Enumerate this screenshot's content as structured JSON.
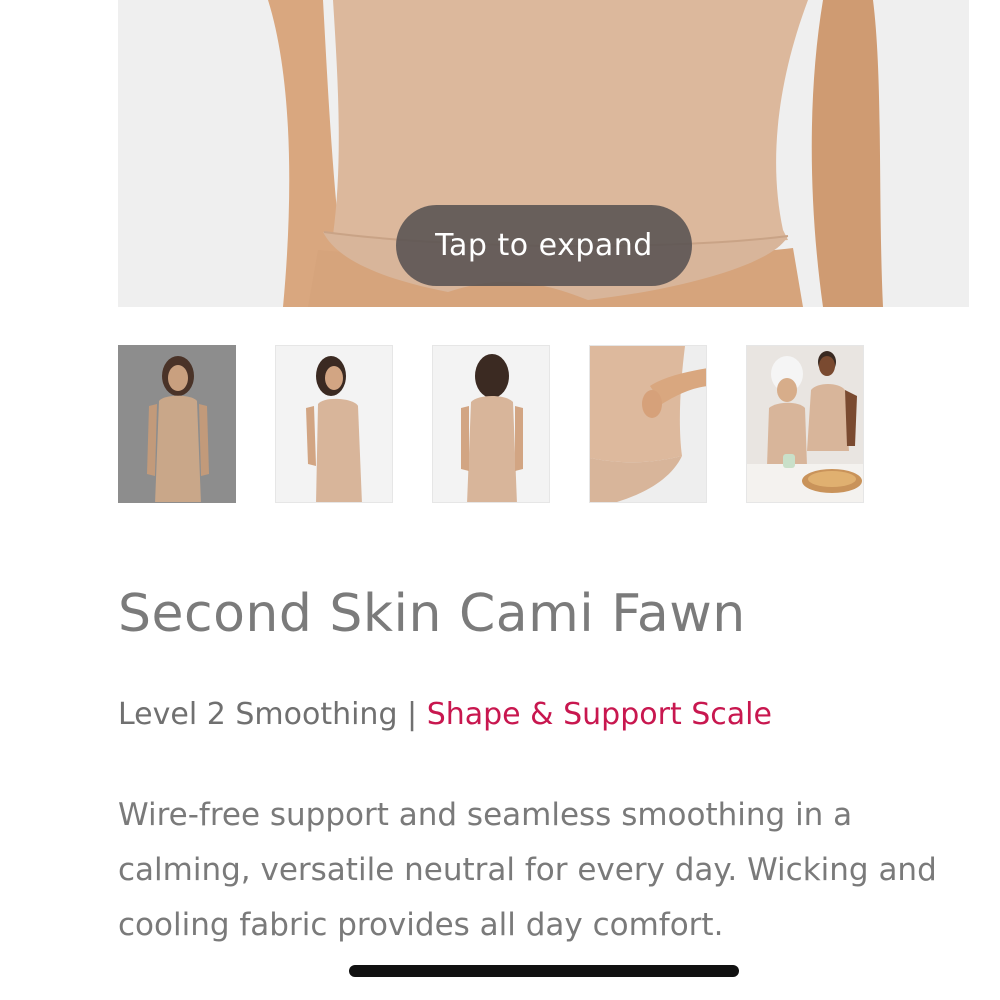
{
  "hero": {
    "tap_label": "Tap to expand",
    "image": "product-closeup-image"
  },
  "thumbnails": [
    {
      "image": "model-front-thumbnail",
      "selected": true
    },
    {
      "image": "model-side-thumbnail",
      "selected": false
    },
    {
      "image": "model-back-thumbnail",
      "selected": false
    },
    {
      "image": "fabric-detail-thumbnail",
      "selected": false
    },
    {
      "image": "lifestyle-thumbnail",
      "selected": false
    }
  ],
  "product": {
    "title": "Second Skin Cami Fawn",
    "smoothing_level": "Level 2 Smoothing",
    "separator": "|",
    "scale_link": "Shape & Support Scale",
    "description": "Wire-free support and seamless smoothing in a calming, versatile neutral for every day. Wicking and cooling fabric provides all day comfort."
  },
  "colors": {
    "accent": "#c8174f",
    "title_text": "#7b7b7b",
    "body_text": "#7a7a7a",
    "fawn": "#d8b59a",
    "skin": "#d9a77f"
  }
}
